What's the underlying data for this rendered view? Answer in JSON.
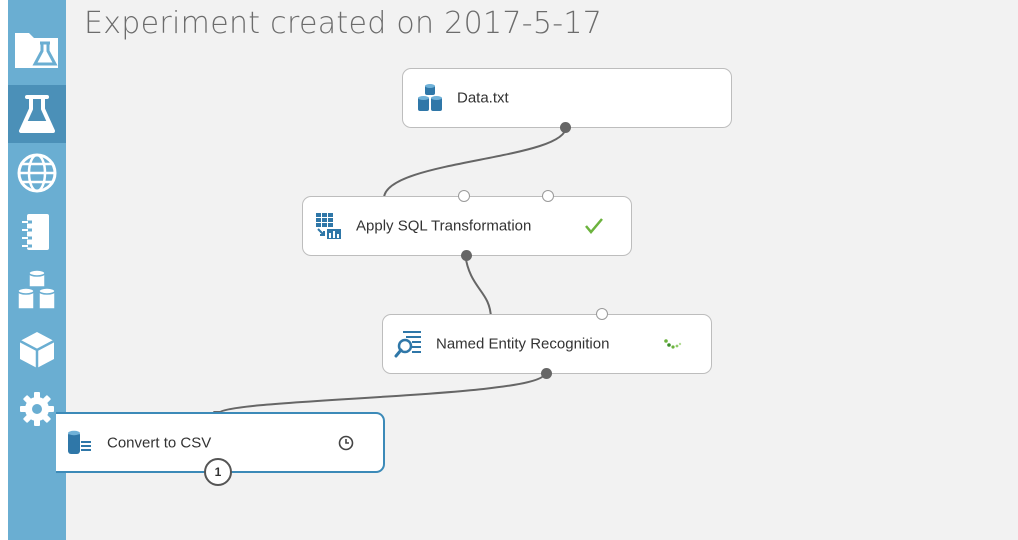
{
  "experiment": {
    "title": "Experiment created on 2017-5-17"
  },
  "sidebar": {
    "items": [
      {
        "name": "projects",
        "icon": "folder-flask-icon"
      },
      {
        "name": "experiments",
        "icon": "flask-icon",
        "active": true
      },
      {
        "name": "web-services",
        "icon": "globe-icon"
      },
      {
        "name": "notebooks",
        "icon": "notebook-icon"
      },
      {
        "name": "datasets",
        "icon": "datasets-icon"
      },
      {
        "name": "trained-models",
        "icon": "cube-icon"
      },
      {
        "name": "settings",
        "icon": "gear-icon"
      }
    ]
  },
  "modules": [
    {
      "label": "Data.txt",
      "icon": "dataset-icon",
      "status": ""
    },
    {
      "label": "Apply SQL Transformation",
      "icon": "sql-transform-icon",
      "status": "completed"
    },
    {
      "label": "Named Entity Recognition",
      "icon": "text-analysis-icon",
      "status": "running"
    },
    {
      "label": "Convert to CSV",
      "icon": "convert-icon",
      "status": "queued",
      "selected": true,
      "badge": "1"
    }
  ],
  "colors": {
    "sidebar": "#6aaed2",
    "sidebar_active": "#4b90b8",
    "canvas": "#f2f2f2",
    "selected_border": "#3c8ab8",
    "check": "#6cb33e",
    "connector": "#666666"
  }
}
